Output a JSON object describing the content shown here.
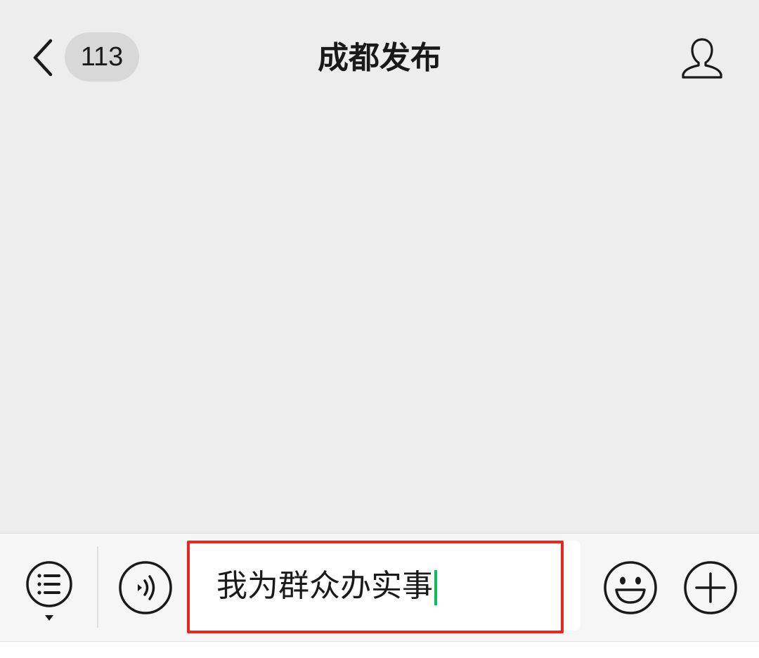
{
  "header": {
    "back_icon": "chevron-left-icon",
    "unread_count": "113",
    "title": "成都发布",
    "profile_icon": "person-icon"
  },
  "toolbar": {
    "menu_icon": "list-menu-icon",
    "voice_icon": "voice-icon",
    "input_value": "我为群众办实事",
    "emoji_icon": "smiley-icon",
    "more_icon": "plus-icon"
  },
  "colors": {
    "background": "#ededed",
    "highlight_border": "#e8281f",
    "caret": "#07c160"
  }
}
